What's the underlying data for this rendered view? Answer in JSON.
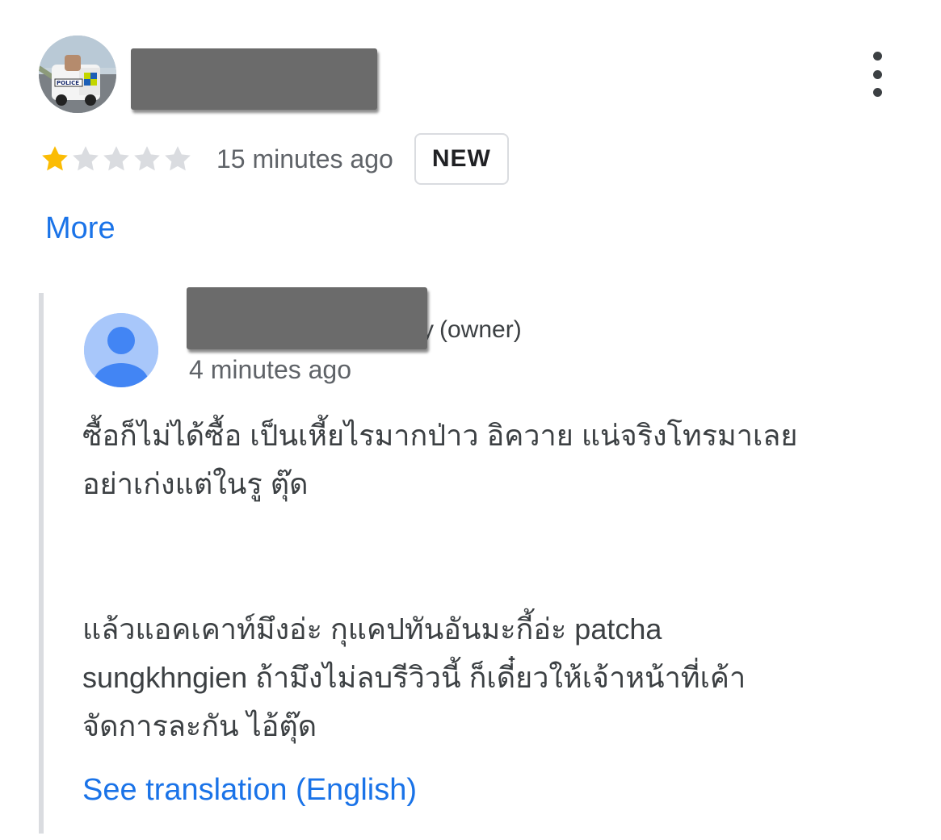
{
  "review": {
    "rating": 1,
    "max_rating": 5,
    "time": "15 minutes ago",
    "badge": "NEW",
    "more_label": "More",
    "star_color_filled": "#fbbc04",
    "star_color_empty": "#dadce0"
  },
  "reply": {
    "owner_tag": "(owner)",
    "owner_name_tail": "y",
    "time": "4 minutes ago",
    "paragraph1": {
      "line1": "ซื้อก็ไม่ได้ซื้อ เป็นเหี้ยไรมากป่าว อิควาย แน่จริงโทรมาเลย",
      "line2": "อย่าเก่งแต่ในรู ตุ๊ด"
    },
    "paragraph2": {
      "line1": "แล้วแอคเคาท์มึงอ่ะ กุแคปทันอันมะกี้อ่ะ patcha",
      "line2": "sungkhngien ถ้ามึงไม่ลบรีวิวนี้ ก็เดี๋ยวให้เจ้าหน้าที่เค้า",
      "line3": "จัดการละกัน ไอ้ตุ๊ด"
    },
    "see_translation_label": "See translation (English)"
  },
  "colors": {
    "link": "#1a73e8",
    "secondary_text": "#5f6368",
    "reply_bar": "#dadce0",
    "owner_avatar_bg": "#a8c7fa",
    "owner_avatar_fg": "#4285f4"
  },
  "icons": {
    "menu": "more-vert-icon",
    "star": "star-icon",
    "owner_avatar": "default-user-icon",
    "reviewer_avatar": "profile-photo-police-car"
  }
}
